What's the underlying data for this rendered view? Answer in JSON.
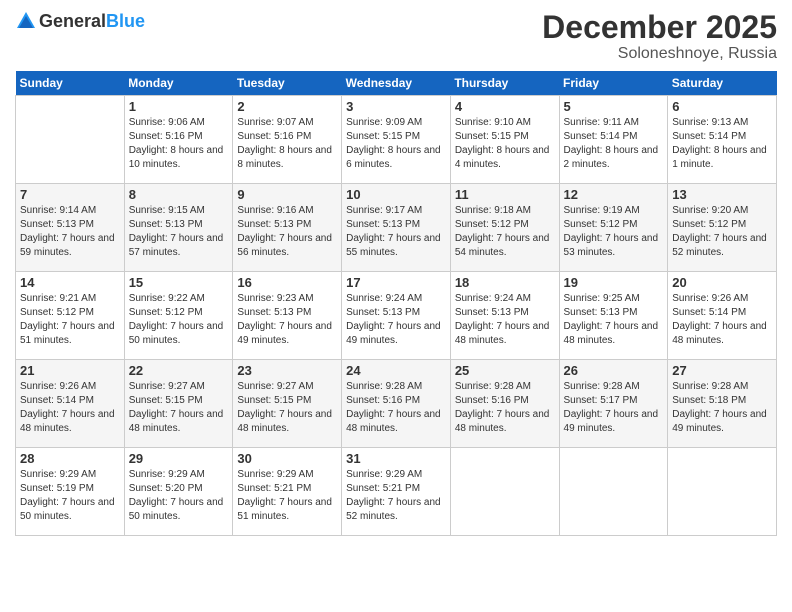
{
  "header": {
    "logo_general": "General",
    "logo_blue": "Blue",
    "month": "December 2025",
    "location": "Soloneshnoye, Russia"
  },
  "days_of_week": [
    "Sunday",
    "Monday",
    "Tuesday",
    "Wednesday",
    "Thursday",
    "Friday",
    "Saturday"
  ],
  "weeks": [
    [
      {
        "day": "",
        "sunrise": "",
        "sunset": "",
        "daylight": ""
      },
      {
        "day": "1",
        "sunrise": "Sunrise: 9:06 AM",
        "sunset": "Sunset: 5:16 PM",
        "daylight": "Daylight: 8 hours and 10 minutes."
      },
      {
        "day": "2",
        "sunrise": "Sunrise: 9:07 AM",
        "sunset": "Sunset: 5:16 PM",
        "daylight": "Daylight: 8 hours and 8 minutes."
      },
      {
        "day": "3",
        "sunrise": "Sunrise: 9:09 AM",
        "sunset": "Sunset: 5:15 PM",
        "daylight": "Daylight: 8 hours and 6 minutes."
      },
      {
        "day": "4",
        "sunrise": "Sunrise: 9:10 AM",
        "sunset": "Sunset: 5:15 PM",
        "daylight": "Daylight: 8 hours and 4 minutes."
      },
      {
        "day": "5",
        "sunrise": "Sunrise: 9:11 AM",
        "sunset": "Sunset: 5:14 PM",
        "daylight": "Daylight: 8 hours and 2 minutes."
      },
      {
        "day": "6",
        "sunrise": "Sunrise: 9:13 AM",
        "sunset": "Sunset: 5:14 PM",
        "daylight": "Daylight: 8 hours and 1 minute."
      }
    ],
    [
      {
        "day": "7",
        "sunrise": "Sunrise: 9:14 AM",
        "sunset": "Sunset: 5:13 PM",
        "daylight": "Daylight: 7 hours and 59 minutes."
      },
      {
        "day": "8",
        "sunrise": "Sunrise: 9:15 AM",
        "sunset": "Sunset: 5:13 PM",
        "daylight": "Daylight: 7 hours and 57 minutes."
      },
      {
        "day": "9",
        "sunrise": "Sunrise: 9:16 AM",
        "sunset": "Sunset: 5:13 PM",
        "daylight": "Daylight: 7 hours and 56 minutes."
      },
      {
        "day": "10",
        "sunrise": "Sunrise: 9:17 AM",
        "sunset": "Sunset: 5:13 PM",
        "daylight": "Daylight: 7 hours and 55 minutes."
      },
      {
        "day": "11",
        "sunrise": "Sunrise: 9:18 AM",
        "sunset": "Sunset: 5:12 PM",
        "daylight": "Daylight: 7 hours and 54 minutes."
      },
      {
        "day": "12",
        "sunrise": "Sunrise: 9:19 AM",
        "sunset": "Sunset: 5:12 PM",
        "daylight": "Daylight: 7 hours and 53 minutes."
      },
      {
        "day": "13",
        "sunrise": "Sunrise: 9:20 AM",
        "sunset": "Sunset: 5:12 PM",
        "daylight": "Daylight: 7 hours and 52 minutes."
      }
    ],
    [
      {
        "day": "14",
        "sunrise": "Sunrise: 9:21 AM",
        "sunset": "Sunset: 5:12 PM",
        "daylight": "Daylight: 7 hours and 51 minutes."
      },
      {
        "day": "15",
        "sunrise": "Sunrise: 9:22 AM",
        "sunset": "Sunset: 5:12 PM",
        "daylight": "Daylight: 7 hours and 50 minutes."
      },
      {
        "day": "16",
        "sunrise": "Sunrise: 9:23 AM",
        "sunset": "Sunset: 5:13 PM",
        "daylight": "Daylight: 7 hours and 49 minutes."
      },
      {
        "day": "17",
        "sunrise": "Sunrise: 9:24 AM",
        "sunset": "Sunset: 5:13 PM",
        "daylight": "Daylight: 7 hours and 49 minutes."
      },
      {
        "day": "18",
        "sunrise": "Sunrise: 9:24 AM",
        "sunset": "Sunset: 5:13 PM",
        "daylight": "Daylight: 7 hours and 48 minutes."
      },
      {
        "day": "19",
        "sunrise": "Sunrise: 9:25 AM",
        "sunset": "Sunset: 5:13 PM",
        "daylight": "Daylight: 7 hours and 48 minutes."
      },
      {
        "day": "20",
        "sunrise": "Sunrise: 9:26 AM",
        "sunset": "Sunset: 5:14 PM",
        "daylight": "Daylight: 7 hours and 48 minutes."
      }
    ],
    [
      {
        "day": "21",
        "sunrise": "Sunrise: 9:26 AM",
        "sunset": "Sunset: 5:14 PM",
        "daylight": "Daylight: 7 hours and 48 minutes."
      },
      {
        "day": "22",
        "sunrise": "Sunrise: 9:27 AM",
        "sunset": "Sunset: 5:15 PM",
        "daylight": "Daylight: 7 hours and 48 minutes."
      },
      {
        "day": "23",
        "sunrise": "Sunrise: 9:27 AM",
        "sunset": "Sunset: 5:15 PM",
        "daylight": "Daylight: 7 hours and 48 minutes."
      },
      {
        "day": "24",
        "sunrise": "Sunrise: 9:28 AM",
        "sunset": "Sunset: 5:16 PM",
        "daylight": "Daylight: 7 hours and 48 minutes."
      },
      {
        "day": "25",
        "sunrise": "Sunrise: 9:28 AM",
        "sunset": "Sunset: 5:16 PM",
        "daylight": "Daylight: 7 hours and 48 minutes."
      },
      {
        "day": "26",
        "sunrise": "Sunrise: 9:28 AM",
        "sunset": "Sunset: 5:17 PM",
        "daylight": "Daylight: 7 hours and 49 minutes."
      },
      {
        "day": "27",
        "sunrise": "Sunrise: 9:28 AM",
        "sunset": "Sunset: 5:18 PM",
        "daylight": "Daylight: 7 hours and 49 minutes."
      }
    ],
    [
      {
        "day": "28",
        "sunrise": "Sunrise: 9:29 AM",
        "sunset": "Sunset: 5:19 PM",
        "daylight": "Daylight: 7 hours and 50 minutes."
      },
      {
        "day": "29",
        "sunrise": "Sunrise: 9:29 AM",
        "sunset": "Sunset: 5:20 PM",
        "daylight": "Daylight: 7 hours and 50 minutes."
      },
      {
        "day": "30",
        "sunrise": "Sunrise: 9:29 AM",
        "sunset": "Sunset: 5:21 PM",
        "daylight": "Daylight: 7 hours and 51 minutes."
      },
      {
        "day": "31",
        "sunrise": "Sunrise: 9:29 AM",
        "sunset": "Sunset: 5:21 PM",
        "daylight": "Daylight: 7 hours and 52 minutes."
      },
      {
        "day": "",
        "sunrise": "",
        "sunset": "",
        "daylight": ""
      },
      {
        "day": "",
        "sunrise": "",
        "sunset": "",
        "daylight": ""
      },
      {
        "day": "",
        "sunrise": "",
        "sunset": "",
        "daylight": ""
      }
    ]
  ]
}
